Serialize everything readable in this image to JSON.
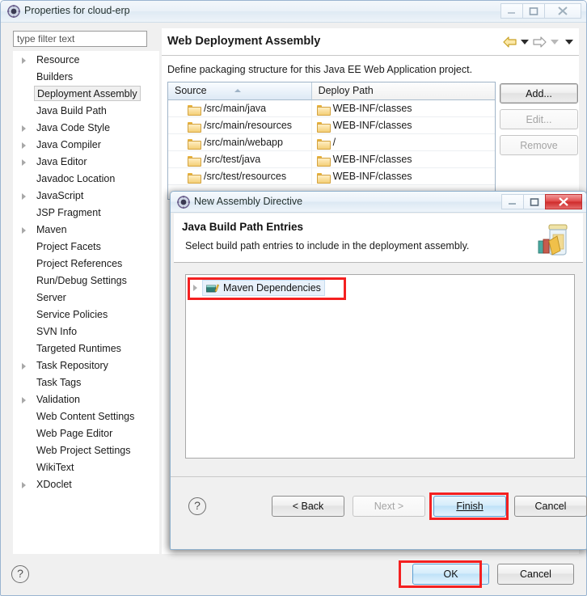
{
  "outer_window": {
    "title": "Properties for cloud-erp",
    "icon": "eclipse-properties-icon",
    "controls": {
      "minimize": "minimize-icon",
      "maximize": "maximize-icon",
      "close": "close-icon"
    }
  },
  "filter": {
    "placeholder": "type filter text",
    "value": ""
  },
  "sidebar": {
    "items": [
      {
        "label": "Resource",
        "expandable": true,
        "selected": false
      },
      {
        "label": "Builders",
        "expandable": false,
        "selected": false
      },
      {
        "label": "Deployment Assembly",
        "expandable": false,
        "selected": true
      },
      {
        "label": "Java Build Path",
        "expandable": false,
        "selected": false
      },
      {
        "label": "Java Code Style",
        "expandable": true,
        "selected": false
      },
      {
        "label": "Java Compiler",
        "expandable": true,
        "selected": false
      },
      {
        "label": "Java Editor",
        "expandable": true,
        "selected": false
      },
      {
        "label": "Javadoc Location",
        "expandable": false,
        "selected": false
      },
      {
        "label": "JavaScript",
        "expandable": true,
        "selected": false
      },
      {
        "label": "JSP Fragment",
        "expandable": false,
        "selected": false
      },
      {
        "label": "Maven",
        "expandable": true,
        "selected": false
      },
      {
        "label": "Project Facets",
        "expandable": false,
        "selected": false
      },
      {
        "label": "Project References",
        "expandable": false,
        "selected": false
      },
      {
        "label": "Run/Debug Settings",
        "expandable": false,
        "selected": false
      },
      {
        "label": "Server",
        "expandable": false,
        "selected": false
      },
      {
        "label": "Service Policies",
        "expandable": false,
        "selected": false
      },
      {
        "label": "SVN Info",
        "expandable": false,
        "selected": false
      },
      {
        "label": "Targeted Runtimes",
        "expandable": false,
        "selected": false
      },
      {
        "label": "Task Repository",
        "expandable": true,
        "selected": false
      },
      {
        "label": "Task Tags",
        "expandable": false,
        "selected": false
      },
      {
        "label": "Validation",
        "expandable": true,
        "selected": false
      },
      {
        "label": "Web Content Settings",
        "expandable": false,
        "selected": false
      },
      {
        "label": "Web Page Editor",
        "expandable": false,
        "selected": false
      },
      {
        "label": "Web Project Settings",
        "expandable": false,
        "selected": false
      },
      {
        "label": "WikiText",
        "expandable": false,
        "selected": false
      },
      {
        "label": "XDoclet",
        "expandable": true,
        "selected": false
      }
    ]
  },
  "page": {
    "heading": "Web Deployment Assembly",
    "description": "Define packaging structure for this Java EE Web Application project.",
    "nav": {
      "back_icon": "back-arrow-icon",
      "back_menu_icon": "chevron-down-icon",
      "forward_icon": "forward-arrow-icon",
      "forward_menu_icon": "chevron-down-icon",
      "view_menu_icon": "chevron-down-icon"
    }
  },
  "table": {
    "columns": [
      "Source",
      "Deploy Path"
    ],
    "sort_column": "Source",
    "sort_direction": "ascending",
    "rows": [
      {
        "source": "/src/main/java",
        "deploy": "WEB-INF/classes"
      },
      {
        "source": "/src/main/resources",
        "deploy": "WEB-INF/classes"
      },
      {
        "source": "/src/main/webapp",
        "deploy": "/"
      },
      {
        "source": "/src/test/java",
        "deploy": "WEB-INF/classes"
      },
      {
        "source": "/src/test/resources",
        "deploy": "WEB-INF/classes"
      }
    ]
  },
  "side_buttons": [
    {
      "label": "Add...",
      "enabled": true
    },
    {
      "label": "Edit...",
      "enabled": false
    },
    {
      "label": "Remove",
      "enabled": false
    }
  ],
  "props_footer": {
    "help_icon": "help-question-icon",
    "ok_label": "OK",
    "cancel_label": "Cancel",
    "ok_highlighted": true
  },
  "dialog": {
    "title": "New Assembly Directive",
    "icon": "eclipse-wizard-icon",
    "heading": "Java Build Path Entries",
    "subtext": "Select build path entries to include in the deployment assembly.",
    "banner_icon": "jar-with-books-icon",
    "tree": [
      {
        "label": "Maven Dependencies",
        "expandable": true,
        "selected": true,
        "icon": "maven-dependencies-icon",
        "highlighted": true
      }
    ],
    "help_icon": "help-question-icon",
    "buttons": [
      {
        "label": "< Back",
        "enabled": true,
        "default": false,
        "highlighted": false
      },
      {
        "label": "Next >",
        "enabled": false,
        "default": false,
        "highlighted": false
      },
      {
        "label": "Finish",
        "enabled": true,
        "default": true,
        "highlighted": true
      },
      {
        "label": "Cancel",
        "enabled": true,
        "default": false,
        "highlighted": false
      }
    ],
    "controls": {
      "minimize": "minimize-icon",
      "maximize": "maximize-icon",
      "close": "close-icon"
    }
  },
  "colors": {
    "highlight_box": "#f42020",
    "default_button": "#5a9fd4",
    "folder": "#e8b23c",
    "selection": "#e8f1fb"
  }
}
